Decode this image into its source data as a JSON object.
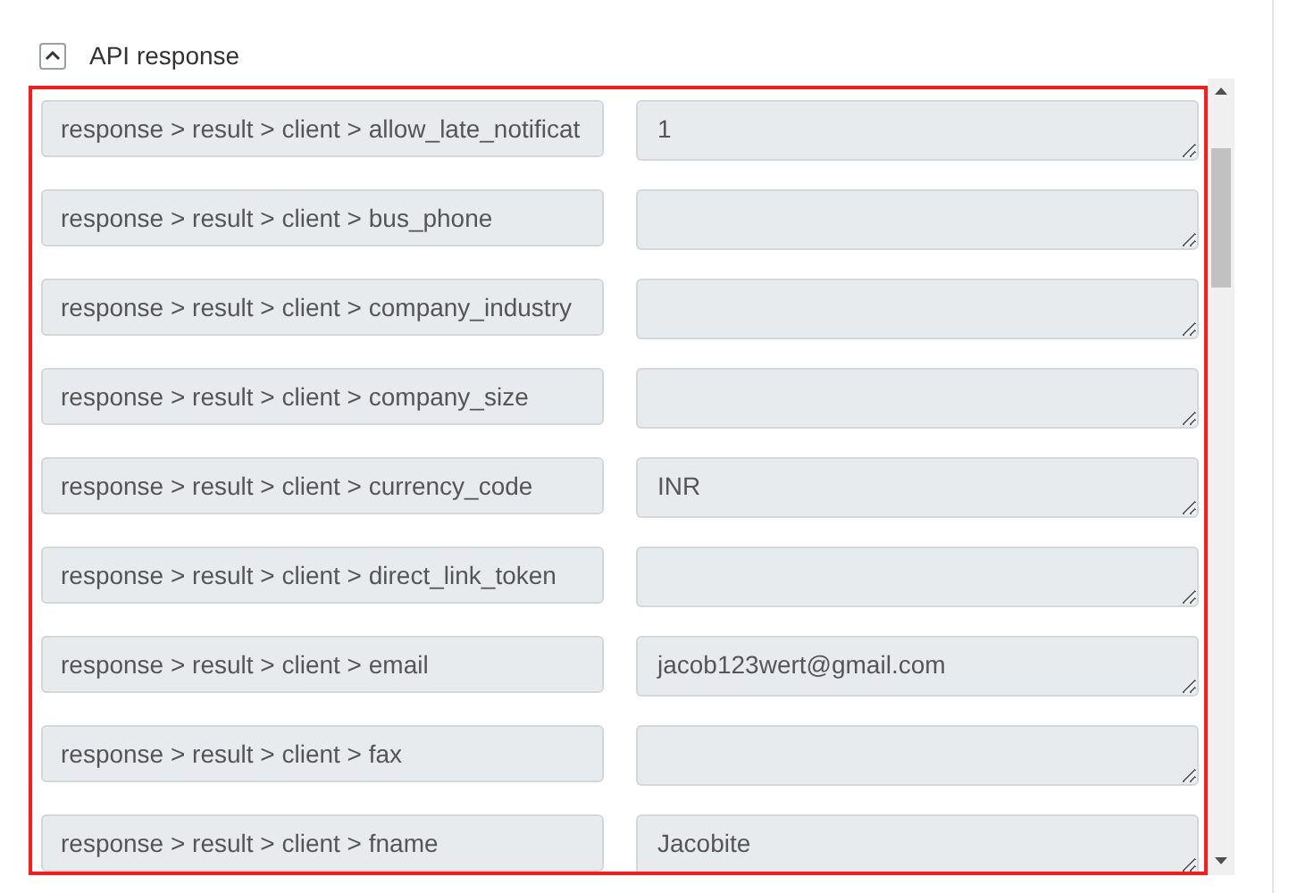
{
  "section": {
    "title": "API response",
    "expanded": true
  },
  "rows": [
    {
      "field": "response > result > client > allow_late_notificat",
      "value": "1"
    },
    {
      "field": "response > result > client > bus_phone",
      "value": ""
    },
    {
      "field": "response > result > client > company_industry",
      "value": ""
    },
    {
      "field": "response > result > client > company_size",
      "value": ""
    },
    {
      "field": "response > result > client > currency_code",
      "value": "INR"
    },
    {
      "field": "response > result > client > direct_link_token",
      "value": ""
    },
    {
      "field": "response > result > client > email",
      "value": "jacob123wert@gmail.com"
    },
    {
      "field": "response > result > client > fax",
      "value": ""
    },
    {
      "field": "response > result > client > fname",
      "value": "Jacobite"
    }
  ]
}
